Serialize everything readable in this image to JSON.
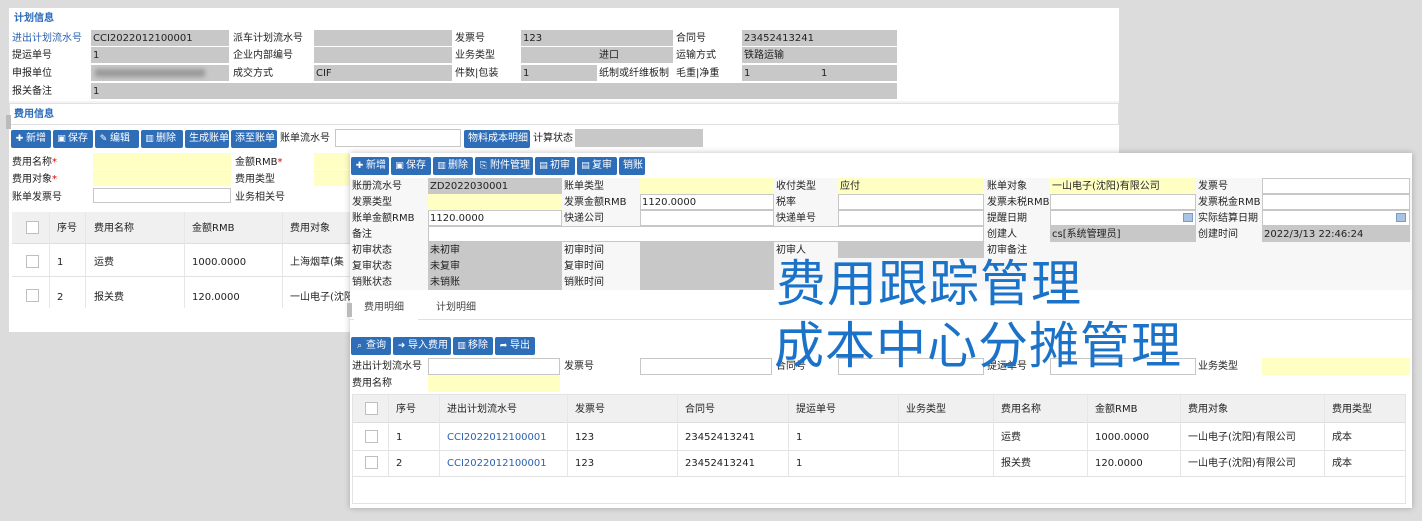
{
  "plan": {
    "title": "计划信息",
    "fields": {
      "plan_no_label": "进出计划流水号",
      "plan_no": "CCI2022012100001",
      "dispatch_no_label": "派车计划流水号",
      "invoice_label": "发票号",
      "invoice": "123",
      "contract_label": "合同号",
      "contract": "23452413241",
      "bl_label": "提运单号",
      "bl": "1",
      "internal_no_label": "企业内部编号",
      "biz_type_label": "业务类型",
      "biz_type": "进口",
      "transport_label": "运输方式",
      "transport": "铁路运输",
      "declarer_label": "申报单位",
      "deal_label": "成交方式",
      "deal": "CIF",
      "pieces_label": "件数|包装",
      "pieces": "1",
      "paper_label": "纸制或纤维板制",
      "weight_label": "毛重|净重",
      "gross": "1",
      "net": "1",
      "remark_label": "报关备注",
      "remark": "1"
    }
  },
  "fee": {
    "title": "费用信息",
    "toolbar": [
      "新增",
      "保存",
      "编辑",
      "删除",
      "生成账单",
      "添至账单"
    ],
    "bill_no_label": "账单流水号",
    "material_btn": "物料成本明细",
    "calc_status_label": "计算状态",
    "form": {
      "fee_name": "费用名称",
      "amount": "金额RMB",
      "fee_target": "费用对象",
      "fee_type": "费用类型",
      "bill_invoice": "账单发票号",
      "biz_related": "业务相关号",
      "required": "*"
    },
    "columns": [
      "序号",
      "费用名称",
      "金额RMB",
      "费用对象"
    ],
    "rows": [
      {
        "no": "1",
        "name": "运费",
        "amount": "1000.0000",
        "target": "上海烟草(集"
      },
      {
        "no": "2",
        "name": "报关费",
        "amount": "120.0000",
        "target": "一山电子(沈阳"
      }
    ]
  },
  "bill": {
    "toolbar": [
      "新增",
      "保存",
      "删除",
      "附件管理",
      "初审",
      "复审",
      "销账"
    ],
    "fields": {
      "bill_no_label": "账册流水号",
      "bill_no": "ZD2022030001",
      "bill_type_label": "账单类型",
      "pay_type_label": "收付类型",
      "pay_type": "应付",
      "bill_target_label": "账单对象",
      "bill_target": "一山电子(沈阳)有限公司",
      "invoice_no_label": "发票号",
      "invoice_type_label": "发票类型",
      "invoice_amount_label": "发票金额RMB",
      "invoice_amount": "1120.0000",
      "tax_rate_label": "税率",
      "untaxed_label": "发票未税RMB",
      "tax_label": "发票税金RMB",
      "bill_amount_label": "账单金额RMB",
      "bill_amount": "1120.0000",
      "express_co_label": "快递公司",
      "express_no_label": "快递单号",
      "remind_date_label": "提醒日期",
      "settle_date_label": "实际结算日期",
      "remark_label": "备注",
      "creator_label": "创建人",
      "creator": "cs[系统管理员]",
      "created_label": "创建时间",
      "created": "2022/3/13 22:46:24",
      "first_status_label": "初审状态",
      "first_status": "未初审",
      "first_time_label": "初审时间",
      "first_person_label": "初审人",
      "first_remark_label": "初审备注",
      "second_status_label": "复审状态",
      "second_status": "未复审",
      "second_time_label": "复审时间",
      "write_status_label": "销账状态",
      "write_status": "未销账",
      "write_time_label": "销账时间"
    },
    "tabs": [
      "费用明细",
      "计划明细"
    ],
    "detail_toolbar": [
      "查询",
      "导入费用",
      "移除",
      "导出"
    ],
    "filters": {
      "plan_no": "进出计划流水号",
      "invoice": "发票号",
      "contract": "合同号",
      "bl": "提运单号",
      "biz_type": "业务类型",
      "fee_name": "费用名称"
    },
    "columns": [
      "序号",
      "进出计划流水号",
      "发票号",
      "合同号",
      "提运单号",
      "业务类型",
      "费用名称",
      "金额RMB",
      "费用对象",
      "费用类型"
    ],
    "rows": [
      {
        "no": "1",
        "plan_no": "CCI2022012100001",
        "invoice": "123",
        "contract": "23452413241",
        "bl": "1",
        "biz_type": "",
        "fee_name": "运费",
        "amount": "1000.0000",
        "target": "一山电子(沈阳)有限公司",
        "type": "成本"
      },
      {
        "no": "2",
        "plan_no": "CCI2022012100001",
        "invoice": "123",
        "contract": "23452413241",
        "bl": "1",
        "biz_type": "",
        "fee_name": "报关费",
        "amount": "120.0000",
        "target": "一山电子(沈阳)有限公司",
        "type": "成本"
      }
    ]
  },
  "overlay": {
    "line1": "费用跟踪管理",
    "line2": "成本中心分摊管理"
  },
  "colors": {
    "accent": "#2e6db8",
    "overlay_text": "#1a73c8",
    "readonly": "#c8c8c8",
    "required_bg": "#ffffc4"
  }
}
